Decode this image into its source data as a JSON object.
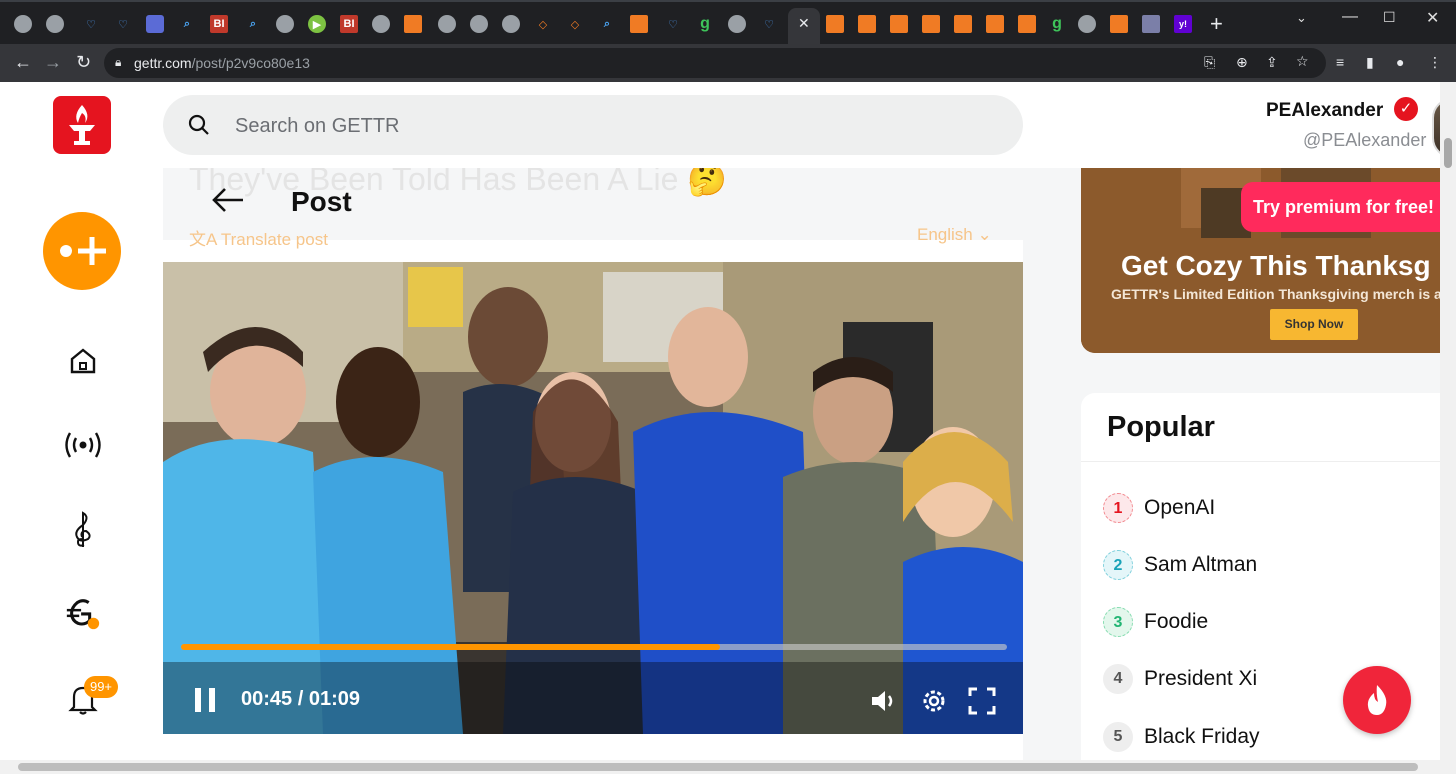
{
  "browser": {
    "url_host": "gettr.com",
    "url_path": "/post/p2v9co80e13",
    "close_tab_label": "✕",
    "new_tab_label": "+",
    "tab_icon_letters": {
      "bi": "BI",
      "g": "g",
      "y": "y!"
    }
  },
  "header": {
    "search_placeholder": "Search on GETTR",
    "user_name": "PEAlexander",
    "user_handle": "@PEAlexander"
  },
  "sidebar": {
    "notification_badge": "99+",
    "icons": [
      "plus-icon",
      "home-icon",
      "live-broadcast-icon",
      "music-clef-icon",
      "gettr-coin-icon",
      "bell-icon"
    ]
  },
  "post": {
    "page_title": "Post",
    "ghost_title": "They've Been Told Has Been A Lie 🤔",
    "translate_label": "Translate post",
    "language_label": "English"
  },
  "video": {
    "current_time": "00:45",
    "separator": "/",
    "duration": "01:09",
    "progress": 0.652
  },
  "ad": {
    "premium_label": "Try premium for free!",
    "title": "Get Cozy This Thanksg",
    "subtitle": "GETTR's Limited Edition Thanksgiving merch is av",
    "shop_label": "Shop Now"
  },
  "popular": {
    "heading": "Popular",
    "items": [
      {
        "rank": "1",
        "label": "OpenAI"
      },
      {
        "rank": "2",
        "label": "Sam Altman"
      },
      {
        "rank": "3",
        "label": "Foodie"
      },
      {
        "rank": "4",
        "label": "President Xi"
      },
      {
        "rank": "5",
        "label": "Black Friday"
      }
    ]
  },
  "colors": {
    "brand_red": "#e5141f",
    "accent_orange": "#ff9500",
    "rank1": "#e5141f",
    "rank2": "#1aa3b8",
    "rank3": "#22b573",
    "rank_default": "#666666"
  }
}
